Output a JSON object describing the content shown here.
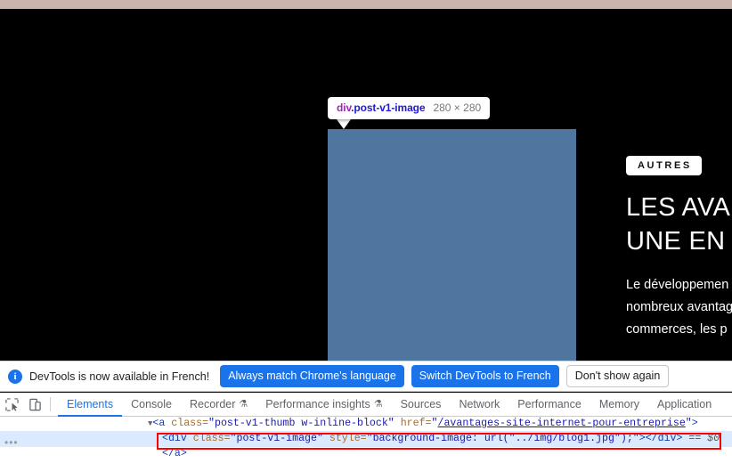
{
  "browser": {
    "top_strip_color": "#cbb4ae"
  },
  "inspector": {
    "tooltip": {
      "tag": "div",
      "classes": ".post-v1-image",
      "dimensions": "280 × 280"
    },
    "highlight_color": "#4f769e"
  },
  "page": {
    "category_badge": "AUTRES",
    "title_line1": "LES AVA",
    "title_line2": "UNE EN",
    "excerpt_line1": "Le développemen",
    "excerpt_line2": "nombreux avantag",
    "excerpt_line3": "commerces, les p",
    "background_color": "#000000"
  },
  "devtools": {
    "banner": {
      "icon": "info-icon",
      "message": "DevTools is now available in French!",
      "primary_button_1": "Always match Chrome's language",
      "primary_button_2": "Switch DevTools to French",
      "secondary_button": "Don't show again"
    },
    "toolbar_icons": [
      {
        "name": "inspect-element-icon"
      },
      {
        "name": "device-toolbar-icon"
      }
    ],
    "tabs": [
      {
        "label": "Elements",
        "active": true,
        "flask": false
      },
      {
        "label": "Console",
        "active": false,
        "flask": false
      },
      {
        "label": "Recorder",
        "active": false,
        "flask": true
      },
      {
        "label": "Performance insights",
        "active": false,
        "flask": true
      },
      {
        "label": "Sources",
        "active": false,
        "flask": false
      },
      {
        "label": "Network",
        "active": false,
        "flask": false
      },
      {
        "label": "Performance",
        "active": false,
        "flask": false
      },
      {
        "label": "Memory",
        "active": false,
        "flask": false
      },
      {
        "label": "Application",
        "active": false,
        "flask": false
      }
    ],
    "dom": {
      "line1": {
        "disclosure": "▼",
        "open": "<a ",
        "attr_class": "class=",
        "val_class": "\"post-v1-thumb w-inline-block\"",
        "attr_href": " href=",
        "val_href_open": "\"",
        "val_href_link": "/avantages-site-internet-pour-entreprise",
        "val_href_close": "\"",
        "close": ">"
      },
      "line2": {
        "open": "<div ",
        "attr_class": "class=",
        "val_class": "\"post-v1-image\"",
        "attr_style": " style=",
        "val_style": "\"background-image: url(\"../img/blog1.jpg\");\"",
        "gt": ">",
        "close_tag": "</div>",
        "selected_marker": " == $0"
      },
      "line3": {
        "text": "</a>"
      },
      "ellipsis": "•••"
    },
    "accent_color": "#1a73e8",
    "selection_outline_color": "#ff0000"
  }
}
